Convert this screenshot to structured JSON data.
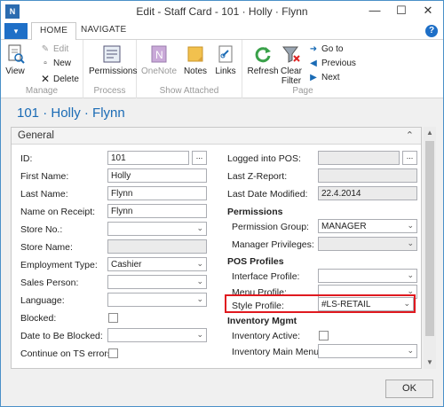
{
  "window": {
    "title": "Edit - Staff Card - 101 · Holly · Flynn",
    "minimize": "—",
    "maximize": "☐",
    "close": "✕"
  },
  "ribbon_tabs": {
    "file_icon": "▾",
    "tabs": [
      "HOME",
      "NAVIGATE"
    ],
    "active": "HOME",
    "help": "?"
  },
  "ribbon": {
    "manage": {
      "label": "Manage",
      "view": "View",
      "edit": "Edit",
      "new": "New",
      "delete": "Delete"
    },
    "process": {
      "label": "Process",
      "permissions": "Permissions"
    },
    "show_attached": {
      "label": "Show Attached",
      "onenote": "OneNote",
      "notes": "Notes",
      "links": "Links"
    },
    "page": {
      "label": "Page",
      "refresh": "Refresh",
      "clear_filter_1": "Clear",
      "clear_filter_2": "Filter",
      "go_to": "Go to",
      "previous": "Previous",
      "next": "Next"
    }
  },
  "page_title": "101 · Holly · Flynn",
  "general": {
    "title": "General",
    "left": {
      "id_label": "ID:",
      "id_value": "101",
      "first_name_label": "First Name:",
      "first_name_value": "Holly",
      "last_name_label": "Last Name:",
      "last_name_value": "Flynn",
      "name_on_receipt_label": "Name on Receipt:",
      "name_on_receipt_value": "Flynn",
      "store_no_label": "Store No.:",
      "store_no_value": "",
      "store_name_label": "Store Name:",
      "store_name_value": "",
      "employment_type_label": "Employment Type:",
      "employment_type_value": "Cashier",
      "sales_person_label": "Sales Person:",
      "sales_person_value": "",
      "language_label": "Language:",
      "language_value": "",
      "blocked_label": "Blocked:",
      "date_blocked_label": "Date to Be Blocked:",
      "date_blocked_value": "",
      "continue_ts_label": "Continue on TS errors:"
    },
    "right": {
      "logged_pos_label": "Logged into POS:",
      "logged_pos_value": "",
      "last_z_label": "Last Z-Report:",
      "last_z_value": "",
      "last_modified_label": "Last Date Modified:",
      "last_modified_value": "22.4.2014",
      "permissions_section": "Permissions",
      "permission_group_label": "Permission Group:",
      "permission_group_value": "MANAGER",
      "manager_privileges_label": "Manager Privileges:",
      "manager_privileges_value": "",
      "pos_profiles_section": "POS Profiles",
      "interface_profile_label": "Interface Profile:",
      "interface_profile_value": "",
      "menu_profile_label": "Menu Profile:",
      "menu_profile_value": "",
      "style_profile_label": "Style Profile:",
      "style_profile_value": "#LS-RETAIL",
      "inventory_section": "Inventory Mgmt",
      "inventory_active_label": "Inventory Active:",
      "inventory_main_menu_label": "Inventory Main Menu:",
      "inventory_main_menu_value": ""
    },
    "assist_glyph": "...",
    "dropdown_glyph": "⌄",
    "collapse_glyph": "⌃"
  },
  "ok_button": "OK",
  "colors": {
    "accent": "#1a6bb5",
    "highlight": "#e0191f",
    "file_button": "#1e6fc7"
  }
}
